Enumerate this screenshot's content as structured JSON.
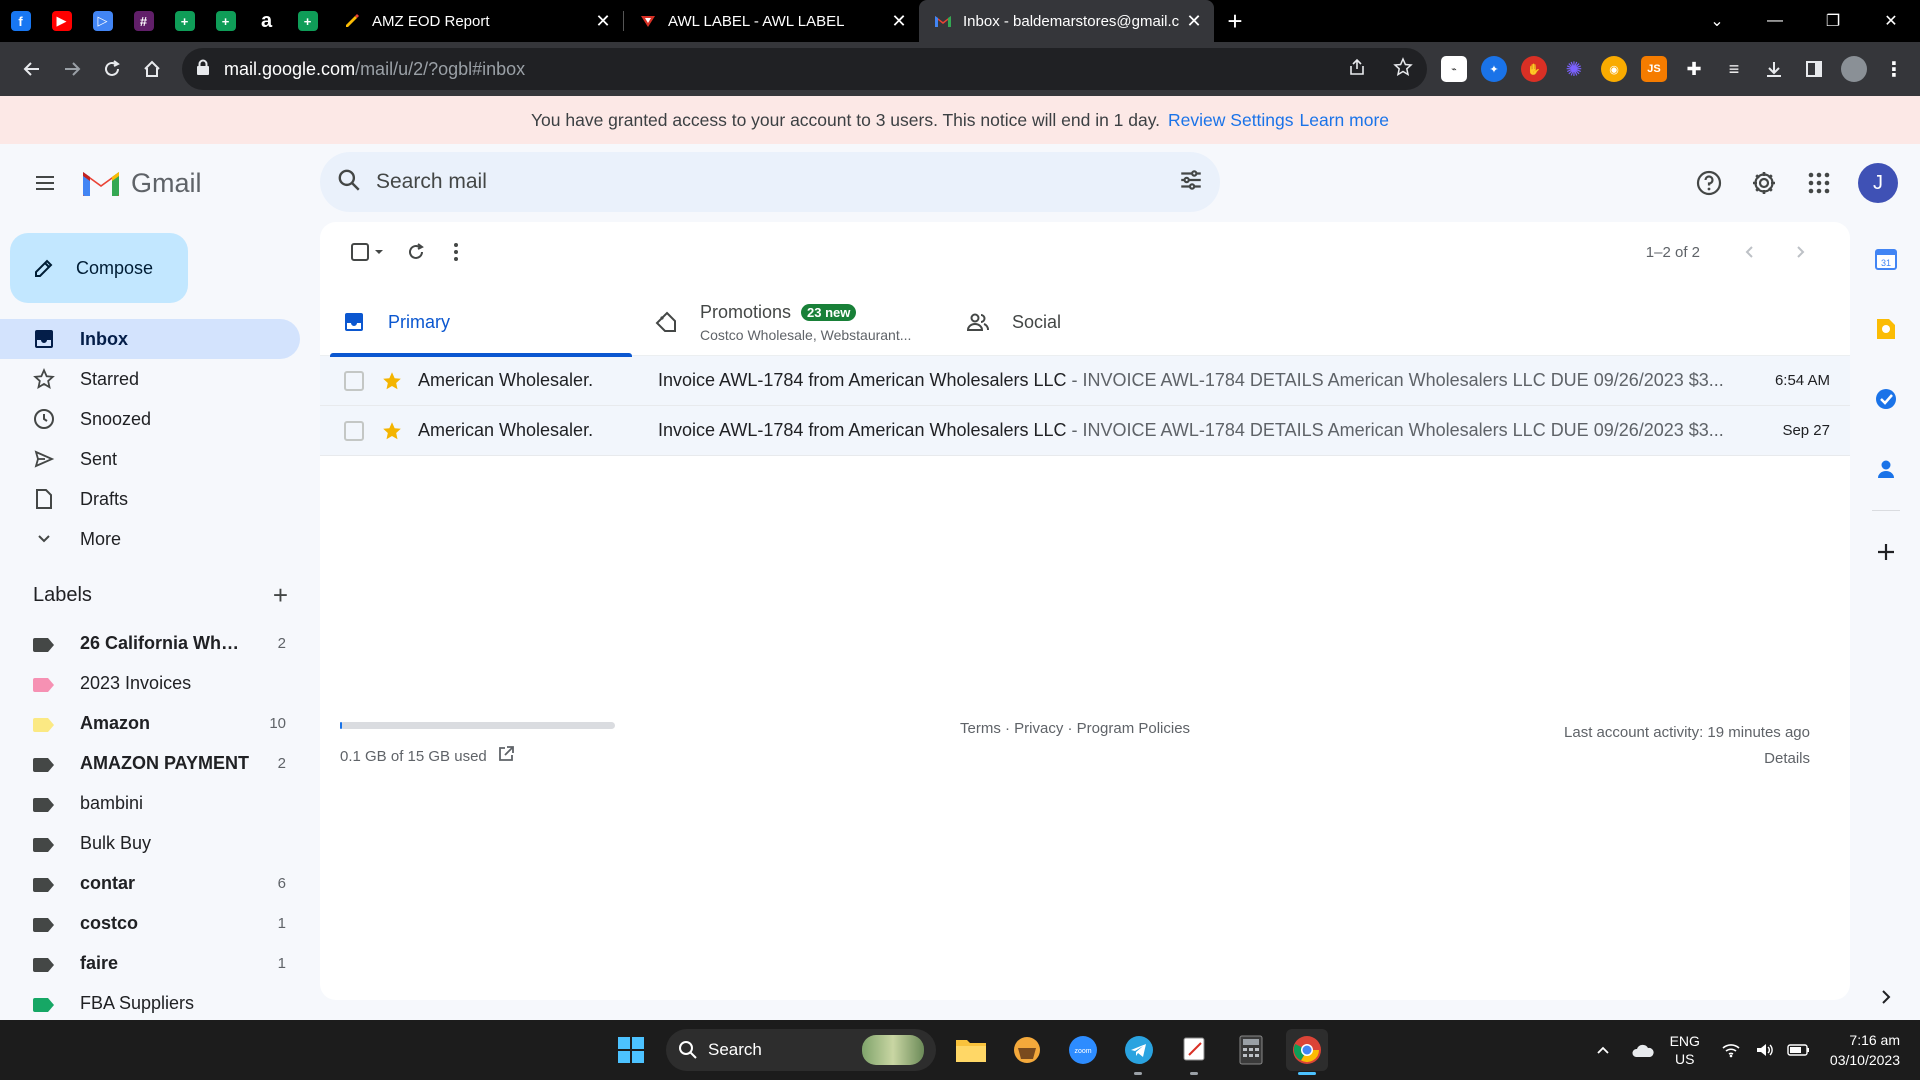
{
  "browser": {
    "pinned_tabs": [
      {
        "name": "facebook-tab",
        "glyph": "f",
        "color": "#1877f2"
      },
      {
        "name": "youtube-tab",
        "glyph": "▶",
        "color": "#ff0000"
      },
      {
        "name": "play-tab",
        "glyph": "▷",
        "color": "#4285f4"
      },
      {
        "name": "slack-tab",
        "glyph": "#",
        "color": "#611f69"
      },
      {
        "name": "sheets-tab-1",
        "glyph": "+",
        "color": "#0f9d58"
      },
      {
        "name": "sheets-tab-2",
        "glyph": "+",
        "color": "#0f9d58"
      },
      {
        "name": "amazon-tab",
        "glyph": "a",
        "color": "#000000"
      },
      {
        "name": "sheets-tab-3",
        "glyph": "+",
        "color": "#0f9d58"
      }
    ],
    "tabs": [
      {
        "title": "AMZ EOD Report",
        "active": false
      },
      {
        "title": "AWL LABEL - AWL LABEL",
        "active": false
      },
      {
        "title": "Inbox - baldemarstores@gmail.c",
        "active": true
      }
    ],
    "url_host": "mail.google.com",
    "url_path": "/mail/u/2/?ogbl#inbox"
  },
  "notice": {
    "text": "You have granted access to your account to 3 users. This notice will end in 1 day.",
    "review_link": "Review Settings",
    "learn_link": "Learn more"
  },
  "header": {
    "app_name": "Gmail",
    "search_placeholder": "Search mail",
    "avatar_letter": "J"
  },
  "compose_label": "Compose",
  "nav": [
    {
      "label": "Inbox",
      "icon": "inbox-icon",
      "active": true
    },
    {
      "label": "Starred",
      "icon": "star-icon",
      "active": false
    },
    {
      "label": "Snoozed",
      "icon": "clock-icon",
      "active": false
    },
    {
      "label": "Sent",
      "icon": "send-icon",
      "active": false
    },
    {
      "label": "Drafts",
      "icon": "draft-icon",
      "active": false
    },
    {
      "label": "More",
      "icon": "chevron-down-icon",
      "active": false
    }
  ],
  "labels_title": "Labels",
  "labels": [
    {
      "name": "26 California Whol...",
      "count": "2",
      "color": "#444746",
      "bold": true
    },
    {
      "name": "2023 Invoices",
      "count": "",
      "color": "#f691b3",
      "bold": false
    },
    {
      "name": "Amazon",
      "count": "10",
      "color": "#fbe983",
      "bold": true
    },
    {
      "name": "AMAZON PAYMENT",
      "count": "2",
      "color": "#444746",
      "bold": true
    },
    {
      "name": "bambini",
      "count": "",
      "color": "#444746",
      "bold": false
    },
    {
      "name": "Bulk Buy",
      "count": "",
      "color": "#444746",
      "bold": false
    },
    {
      "name": "contar",
      "count": "6",
      "color": "#444746",
      "bold": true
    },
    {
      "name": "costco",
      "count": "1",
      "color": "#444746",
      "bold": true
    },
    {
      "name": "faire",
      "count": "1",
      "color": "#444746",
      "bold": true
    },
    {
      "name": "FBA Suppliers",
      "count": "",
      "color": "#16a765",
      "bold": false
    }
  ],
  "pager_text": "1–2 of 2",
  "categories": [
    {
      "label": "Primary",
      "badge": "",
      "sub": "",
      "active": true
    },
    {
      "label": "Promotions",
      "badge": "23 new",
      "sub": "Costco Wholesale, Webstaurant...",
      "active": false
    },
    {
      "label": "Social",
      "badge": "",
      "sub": "",
      "active": false
    }
  ],
  "emails": [
    {
      "sender": "American Wholesaler.",
      "subject": "Invoice AWL-1784 from American Wholesalers LLC",
      "snippet": " - INVOICE AWL-1784 DETAILS American Wholesalers LLC DUE 09/26/2023 $3...",
      "date": "6:54 AM"
    },
    {
      "sender": "American Wholesaler.",
      "subject": "Invoice AWL-1784 from American Wholesalers LLC",
      "snippet": " - INVOICE AWL-1784 DETAILS American Wholesalers LLC DUE 09/26/2023 $3...",
      "date": "Sep 27"
    }
  ],
  "footer": {
    "storage": "0.1 GB of 15 GB used",
    "storage_fraction": 0.0067,
    "terms": "Terms · Privacy · Program Policies",
    "activity": "Last account activity: 19 minutes ago",
    "details": "Details"
  },
  "taskbar": {
    "search_label": "Search",
    "lang_top": "ENG",
    "lang_bottom": "US",
    "time": "7:16 am",
    "date": "03/10/2023"
  },
  "colors": {
    "accent": "#0b57d0",
    "compose_bg": "#c2e7ff",
    "inbox_active_bg": "#d3e3fd",
    "star": "#f4b400",
    "notice_bg": "#fce8e6",
    "promo_badge": "#188038"
  }
}
